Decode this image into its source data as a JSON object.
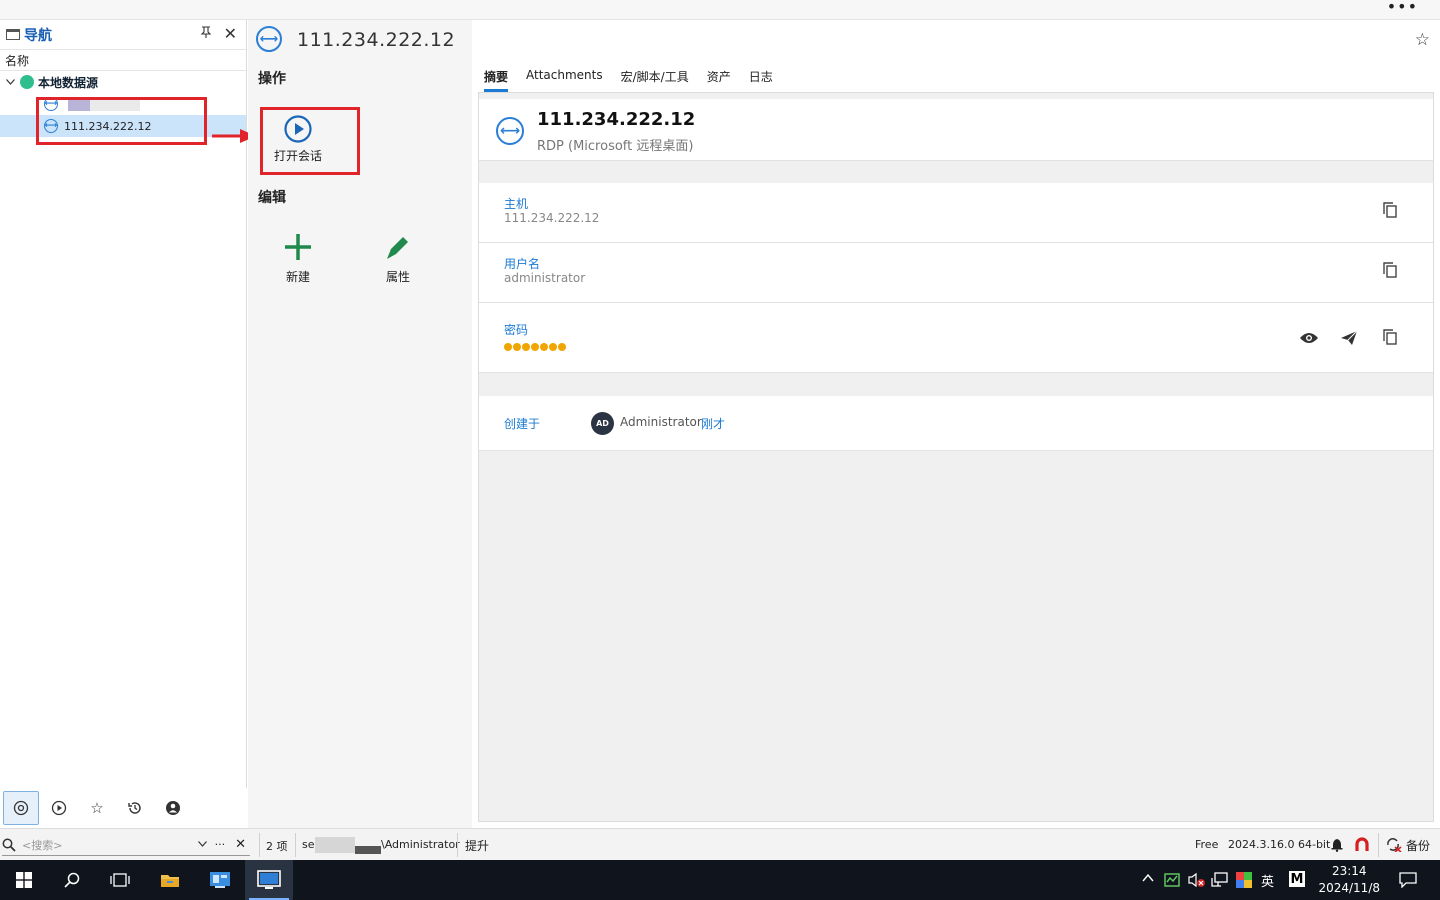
{
  "nav": {
    "title": "导航",
    "column_name": "名称",
    "root_label": "本地数据源",
    "selected_item": "111.234.222.12"
  },
  "actions": {
    "section_operate": "操作",
    "open_session": "打开会话",
    "section_edit": "编辑",
    "new_label": "新建",
    "properties_label": "属性"
  },
  "main": {
    "title": "111.234.222.12",
    "tabs": [
      {
        "label": "摘要"
      },
      {
        "label": "Attachments"
      },
      {
        "label": "宏/脚本/工具"
      },
      {
        "label": "资产"
      },
      {
        "label": "日志"
      }
    ],
    "entry_name": "111.234.222.12",
    "entry_type": "RDP (Microsoft 远程桌面)",
    "fields": {
      "host_label": "主机",
      "host_value": "111.234.222.12",
      "user_label": "用户名",
      "user_value": "administrator",
      "password_label": "密码",
      "password_dots": 7
    },
    "created": {
      "label": "创建于",
      "avatar": "AD",
      "who": "Administrator",
      "when": "刚才"
    }
  },
  "status": {
    "search_placeholder": "<搜索>",
    "count": "2 项",
    "user_prefix": "se",
    "user_suffix": "\\Administrator",
    "elevate": "提升",
    "license": "Free",
    "version": "2024.3.16.0 64-bit",
    "backup": "备份"
  },
  "taskbar": {
    "time": "23:14",
    "date": "2024/11/8",
    "ime": "英"
  },
  "colors": {
    "accent": "#1a7ad4",
    "highlight_red": "#e0242a",
    "password_dot": "#f0a500",
    "add_green": "#1f8a4c"
  }
}
